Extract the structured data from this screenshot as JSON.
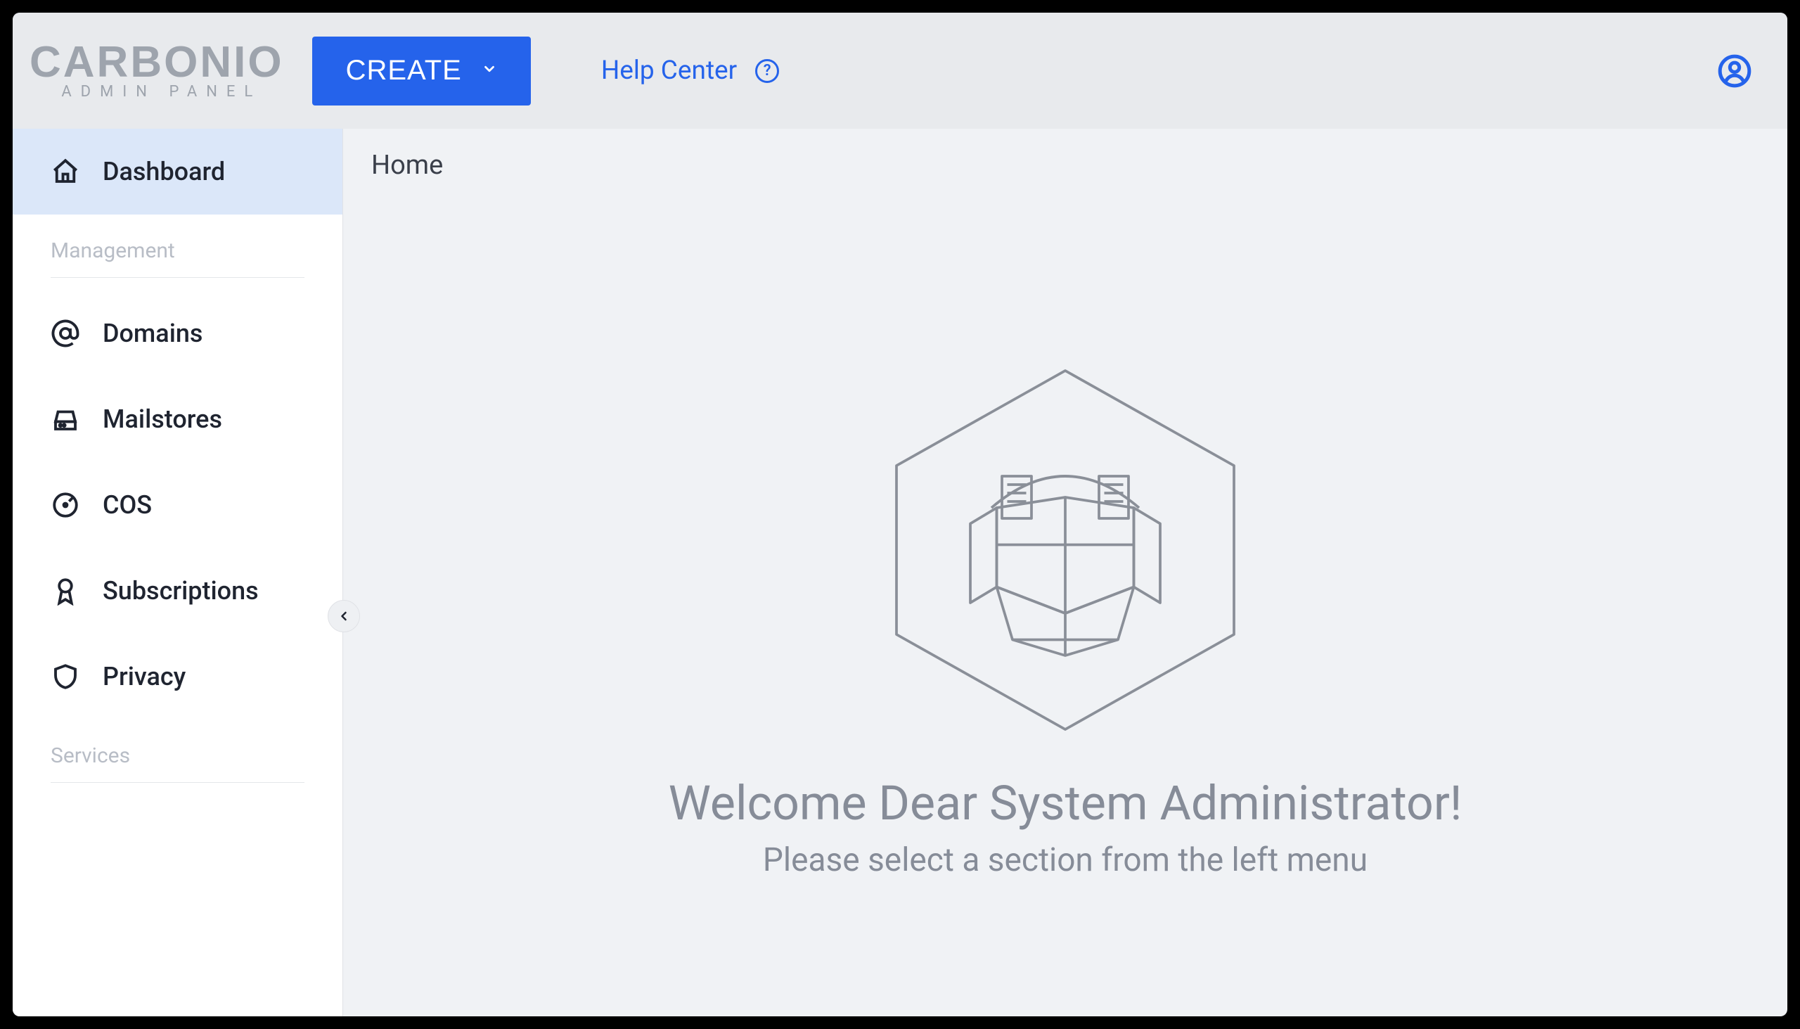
{
  "header": {
    "logo_top": "CARBONIO",
    "logo_sub": "ADMIN PANEL",
    "create_label": "CREATE",
    "help_label": "Help Center"
  },
  "sidebar": {
    "dashboard": "Dashboard",
    "section_management": "Management",
    "section_services": "Services",
    "items": {
      "domains": "Domains",
      "mailstores": "Mailstores",
      "cos": "COS",
      "subscriptions": "Subscriptions",
      "privacy": "Privacy"
    }
  },
  "main": {
    "breadcrumb": "Home",
    "welcome_title": "Welcome Dear System Administrator!",
    "welcome_sub": "Please select a section from the left menu"
  }
}
